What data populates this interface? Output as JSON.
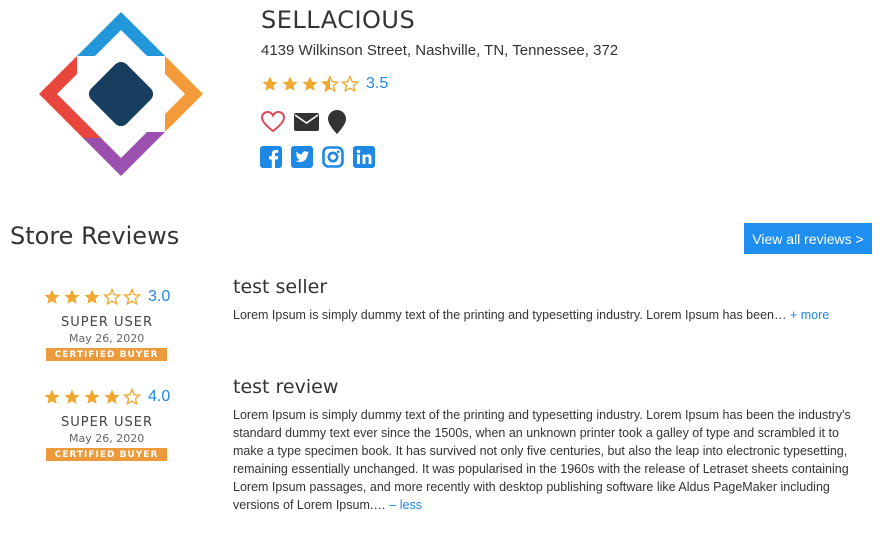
{
  "store": {
    "name": "SELLACIOUS",
    "address": "4139 Wilkinson Street, Nashville, TN, Tennessee, 372",
    "rating": 3.5,
    "rating_text": "3.5"
  },
  "icons": {
    "actions": [
      "heart-icon",
      "envelope-icon",
      "map-marker-icon"
    ],
    "social": [
      "facebook-icon",
      "twitter-icon",
      "instagram-icon",
      "linkedin-icon"
    ]
  },
  "reviews_section": {
    "title": "Store Reviews",
    "view_all_label": "View all reviews >"
  },
  "reviews": [
    {
      "rating": 3.0,
      "rating_text": "3.0",
      "user": "SUPER USER",
      "date": "May 26, 2020",
      "badge": "CERTIFIED BUYER",
      "title": "test seller",
      "body": "Lorem Ipsum is simply dummy text of the printing and typesetting industry. Lorem Ipsum has been…",
      "toggle_label": "+ more"
    },
    {
      "rating": 4.0,
      "rating_text": "4.0",
      "user": "SUPER USER",
      "date": "May 26, 2020",
      "badge": "CERTIFIED BUYER",
      "title": "test review",
      "body": "Lorem Ipsum is simply dummy text of the printing and typesetting industry. Lorem Ipsum has been the industry's standard dummy text ever since the 1500s, when an unknown printer took a galley of type and scrambled it to make a type specimen book. It has survived not only five centuries, but also the leap into electronic typesetting, remaining essentially unchanged. It was popularised in the 1960s with the release of Letraset sheets containing Lorem Ipsum passages, and more recently with desktop publishing software like Aldus PageMaker including versions of Lorem Ipsum.…",
      "toggle_label": "– less"
    }
  ],
  "colors": {
    "star": "#f0a830",
    "accent": "#1e88e5",
    "button": "#1e8ff0",
    "badge": "#ec9a3c",
    "heart": "#e0475b",
    "social": "#1e88e5",
    "dark_icon": "#333333"
  }
}
